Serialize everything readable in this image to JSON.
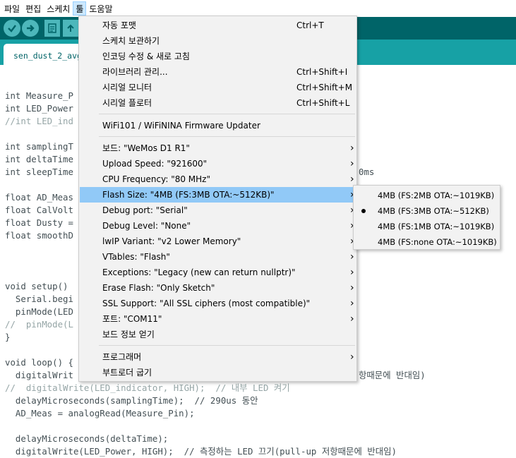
{
  "menubar": {
    "items": [
      "파일",
      "편집",
      "스케치",
      "툴",
      "도움말"
    ],
    "active_index": 3
  },
  "tab": {
    "label": "sen_dust_2_avg"
  },
  "code": [
    {
      "line": "int Measure_P",
      "type": "plain"
    },
    {
      "line": "int LED_Power",
      "type": "plain"
    },
    {
      "line": "//int LED_ind",
      "type": "comment"
    },
    {
      "line": "int samplingT",
      "type": "plain"
    },
    {
      "line": "int deltaTime",
      "type": "plain"
    },
    {
      "line": "int sleepTime",
      "type": "plain"
    },
    {
      "line": "float AD_Meas",
      "type": "plain"
    },
    {
      "line": "float CalVolt",
      "type": "plain"
    },
    {
      "line": "float Dusty =",
      "type": "plain"
    },
    {
      "line": "float smoothD",
      "type": "plain"
    },
    {
      "line": "void setup()",
      "type": "plain"
    },
    {
      "line": "  Serial.begi",
      "type": "plain"
    },
    {
      "line": "  pinMode(LED",
      "type": "plain"
    },
    {
      "line": "//  pinMode(L",
      "type": "comment"
    },
    {
      "line": "}",
      "type": "plain"
    },
    {
      "line": "void loop() {",
      "type": "plain"
    },
    {
      "line": "  digitalWrit",
      "type": "plain"
    },
    {
      "line": "//  digitalWrite(LED_indicator, HIGH);  // 내부 LED 켜기",
      "type": "comment"
    },
    {
      "line": "  delayMicroseconds(samplingTime);  // 290us 동안",
      "type": "plain"
    },
    {
      "line": "  AD_Meas = analogRead(Measure_Pin);",
      "type": "plain"
    },
    {
      "line": "  delayMicroseconds(deltaTime);",
      "type": "plain"
    },
    {
      "line": "  digitalWrite(LED_Power, HIGH);  // 측정하는 LED 끄기(pull-up 저항때문에 반대임)",
      "type": "plain"
    }
  ],
  "code_right_fragments": {
    "sleep_suffix": "0ms",
    "loop_suffix": "항때문에 반대임)"
  },
  "tools_menu": {
    "items": [
      {
        "label": "자동 포맷",
        "shortcut": "Ctrl+T"
      },
      {
        "label": "스케치 보관하기"
      },
      {
        "label": "인코딩 수정 & 새로 고침"
      },
      {
        "label": "라이브러리 관리...",
        "shortcut": "Ctrl+Shift+I"
      },
      {
        "label": "시리얼 모니터",
        "shortcut": "Ctrl+Shift+M"
      },
      {
        "label": "시리얼 플로터",
        "shortcut": "Ctrl+Shift+L"
      },
      {
        "label": "WiFi101 / WiFiNINA Firmware Updater"
      },
      {
        "label": "보드: \"WeMos D1 R1\"",
        "submenu": true
      },
      {
        "label": "Upload Speed: \"921600\"",
        "submenu": true
      },
      {
        "label": "CPU Frequency: \"80 MHz\"",
        "submenu": true
      },
      {
        "label": "Flash Size: \"4MB (FS:3MB OTA:~512KB)\"",
        "submenu": true,
        "highlighted": true
      },
      {
        "label": "Debug port: \"Serial\"",
        "submenu": true
      },
      {
        "label": "Debug Level: \"None\"",
        "submenu": true
      },
      {
        "label": "lwIP Variant: \"v2 Lower Memory\"",
        "submenu": true
      },
      {
        "label": "VTables: \"Flash\"",
        "submenu": true
      },
      {
        "label": "Exceptions: \"Legacy (new can return nullptr)\"",
        "submenu": true
      },
      {
        "label": "Erase Flash: \"Only Sketch\"",
        "submenu": true
      },
      {
        "label": "SSL Support: \"All SSL ciphers (most compatible)\"",
        "submenu": true
      },
      {
        "label": "포트: \"COM11\"",
        "submenu": true
      },
      {
        "label": "보드 정보 얻기"
      },
      {
        "label": "프로그래머",
        "submenu": true
      },
      {
        "label": "부트로더 굽기"
      }
    ]
  },
  "flash_submenu": {
    "items": [
      {
        "label": "4MB (FS:2MB OTA:~1019KB)"
      },
      {
        "label": "4MB (FS:3MB OTA:~512KB)",
        "selected": true
      },
      {
        "label": "4MB (FS:1MB OTA:~1019KB)"
      },
      {
        "label": "4MB (FS:none OTA:~1019KB)"
      }
    ]
  },
  "colors": {
    "toolbar": "#006468",
    "tabbar": "#17a1a5",
    "button": "#4db7bb",
    "highlight": "#91c9f7"
  }
}
